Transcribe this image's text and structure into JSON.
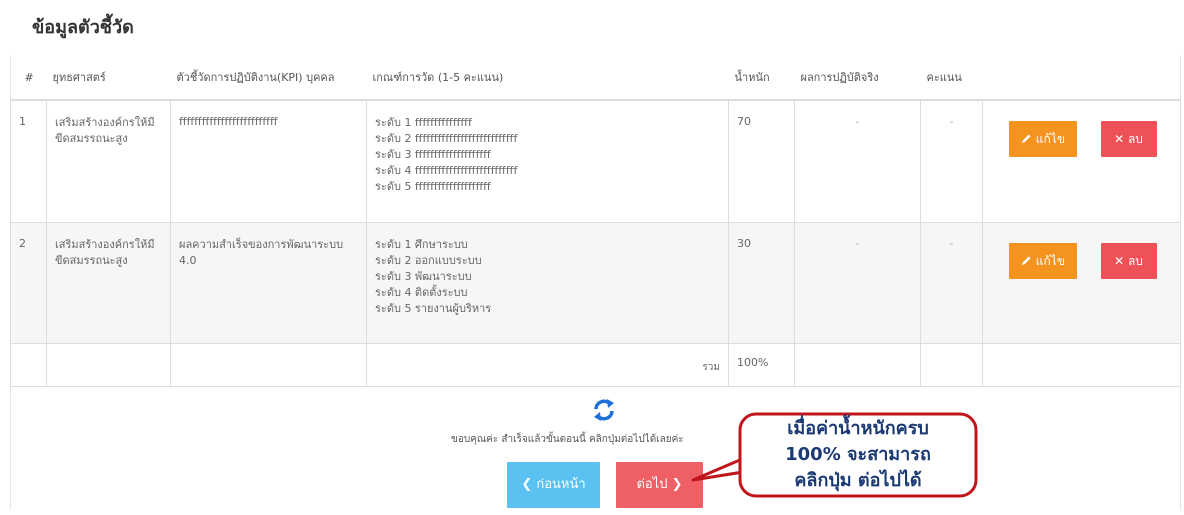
{
  "section_title": "ข้อมูลตัวชี้วัด",
  "table": {
    "headers": [
      "#",
      "ยุทธศาสตร์",
      "ตัวชี้วัดการปฏิบัติงาน(KPI) บุคคล",
      "เกณฑ์การวัด (1-5 คะแนน)",
      "น้ำหนัก",
      "ผลการปฏิบัติจริง",
      "คะแนน",
      ""
    ],
    "rows": [
      {
        "no": "1",
        "strategy": "เสริมสร้างองค์กรให้มีขีดสมรรถนะสูง",
        "kpi": "ffffffffffffffffffffffffff",
        "criteria": [
          "ระดับ 1 fffffffffffffff",
          "ระดับ 2 fffffffffffffffffffffffffff",
          "ระดับ 3 ffffffffffffffffffff",
          "ระดับ 4 fffffffffffffffffffffffffff",
          "ระดับ 5 ffffffffffffffffffff"
        ],
        "weight": "70",
        "actual": "-",
        "score": "-"
      },
      {
        "no": "2",
        "strategy": "เสริมสร้างองค์กรให้มีขีดสมรรถนะสูง",
        "kpi": "ผลความสำเร็จของการพัฒนาระบบ 4.0",
        "criteria": [
          "ระดับ 1 ศึกษาระบบ",
          "ระดับ 2 ออกแบบระบบ",
          "ระดับ 3 พัฒนาระบบ",
          "ระดับ 4 ติดตั้งระบบ",
          "ระดับ 5 รายงานผู้บริหาร"
        ],
        "weight": "30",
        "actual": "-",
        "score": "-"
      }
    ],
    "total_label": "รวม",
    "total_value": "100%"
  },
  "actions": {
    "edit_label": "แก้ไข",
    "delete_label": "ลบ"
  },
  "thanks_text": "ขอบคุณค่ะ สำเร็จแล้วขั้นตอนนี้ คลิกปุ่มต่อไปได้เลยค่ะ",
  "nav": {
    "prev_label": "ก่อนหน้า",
    "next_label": "ต่อไป"
  },
  "callout": {
    "lines": [
      "เมื่อค่าน้ำหนักครบ",
      "100% จะสามารถ",
      "คลิกปุ่ม ต่อไปได้"
    ]
  },
  "colors": {
    "edit": "#f5931f",
    "delete": "#ed5258",
    "prev": "#5bc1f1",
    "next": "#ef6066",
    "refresh_icon": "#1e6fd9",
    "callout_border": "#c0161b"
  },
  "icons": {
    "edit": "pencil-icon",
    "delete": "x-icon",
    "refresh": "refresh-icon",
    "prev": "chevron-left-icon",
    "next": "chevron-right-icon"
  }
}
